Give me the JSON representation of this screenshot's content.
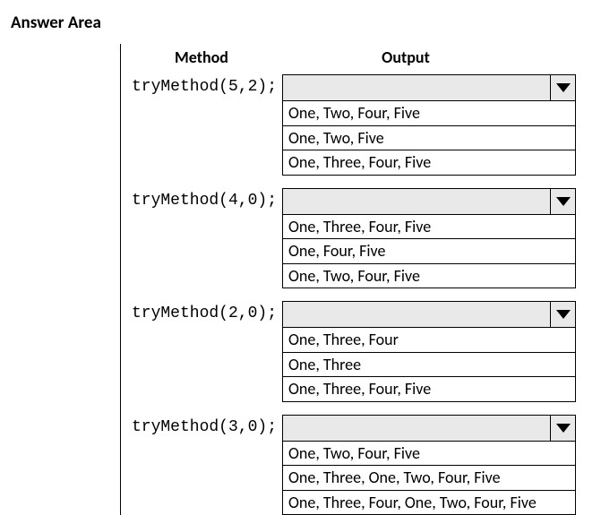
{
  "title": "Answer Area",
  "headers": {
    "method": "Method",
    "output": "Output"
  },
  "rows": [
    {
      "method": "tryMethod(5,2);",
      "options": [
        "One, Two, Four, Five",
        "One, Two, Five",
        "One, Three, Four, Five"
      ]
    },
    {
      "method": "tryMethod(4,0);",
      "options": [
        "One, Three, Four, Five",
        "One, Four, Five",
        "One, Two, Four, Five"
      ]
    },
    {
      "method": "tryMethod(2,0);",
      "options": [
        "One, Three, Four",
        "One, Three",
        "One, Three, Four, Five"
      ]
    },
    {
      "method": "tryMethod(3,0);",
      "options": [
        "One, Two, Four, Five",
        "One, Three, One, Two, Four, Five",
        "One, Three, Four, One, Two, Four, Five"
      ]
    }
  ]
}
